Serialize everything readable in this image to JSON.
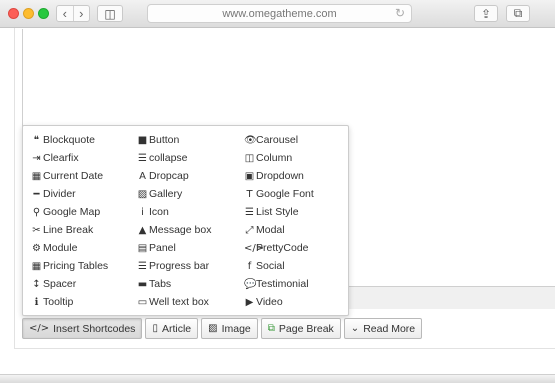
{
  "browser": {
    "url": "www.omegatheme.com",
    "back_glyph": "‹",
    "forward_glyph": "›",
    "sidebar_glyph": "◫",
    "reload_glyph": "↻",
    "share_glyph": "⇪",
    "tabs_glyph": "⧉"
  },
  "shortcodes": [
    {
      "label": "Blockquote",
      "glyph": "❝",
      "icon": "quote-icon"
    },
    {
      "label": "Button",
      "glyph": "■",
      "icon": "square-icon"
    },
    {
      "label": "Carousel",
      "glyph": "👁",
      "icon": "eye-icon"
    },
    {
      "label": "Clearfix",
      "glyph": "⇥",
      "icon": "sign-in-icon"
    },
    {
      "label": "collapse",
      "glyph": "☰",
      "icon": "list-icon"
    },
    {
      "label": "Column",
      "glyph": "◫",
      "icon": "columns-icon"
    },
    {
      "label": "Current Date",
      "glyph": "▦",
      "icon": "calendar-icon"
    },
    {
      "label": "Dropcap",
      "glyph": "A",
      "icon": "font-icon"
    },
    {
      "label": "Dropdown",
      "glyph": "▣",
      "icon": "caret-square-icon"
    },
    {
      "label": "Divider",
      "glyph": "━",
      "icon": "minus-icon"
    },
    {
      "label": "Gallery",
      "glyph": "▨",
      "icon": "picture-icon"
    },
    {
      "label": "Google Font",
      "glyph": "T",
      "icon": "text-height-icon"
    },
    {
      "label": "Google Map",
      "glyph": "⚲",
      "icon": "map-marker-icon"
    },
    {
      "label": "Icon",
      "glyph": "i",
      "icon": "info-icon"
    },
    {
      "label": "List Style",
      "glyph": "☰",
      "icon": "list-ul-icon"
    },
    {
      "label": "Line Break",
      "glyph": "✂",
      "icon": "scissors-icon"
    },
    {
      "label": "Message box",
      "glyph": "▲",
      "icon": "warning-icon"
    },
    {
      "label": "Modal",
      "glyph": "⤢",
      "icon": "expand-icon"
    },
    {
      "label": "Module",
      "glyph": "⚙",
      "icon": "cubes-icon"
    },
    {
      "label": "Panel",
      "glyph": "▤",
      "icon": "panel-icon"
    },
    {
      "label": "PrettyCode",
      "glyph": "</>",
      "icon": "code-icon"
    },
    {
      "label": "Pricing Tables",
      "glyph": "▦",
      "icon": "table-icon"
    },
    {
      "label": "Progress bar",
      "glyph": "☰",
      "icon": "tasks-icon"
    },
    {
      "label": "Social",
      "glyph": "f",
      "icon": "facebook-icon"
    },
    {
      "label": "Spacer",
      "glyph": "↕",
      "icon": "arrows-v-icon"
    },
    {
      "label": "Tabs",
      "glyph": "▬",
      "icon": "folder-icon"
    },
    {
      "label": "Testimonial",
      "glyph": "💬",
      "icon": "comment-icon"
    },
    {
      "label": "Tooltip",
      "glyph": "ℹ",
      "icon": "info-circle-icon"
    },
    {
      "label": "Well text box",
      "glyph": "▭",
      "icon": "square-o-icon"
    },
    {
      "label": "Video",
      "glyph": "▶",
      "icon": "video-camera-icon"
    }
  ],
  "buttons": {
    "insert_shortcodes": {
      "label": "Insert Shortcodes",
      "glyph": "</>"
    },
    "article": {
      "label": "Article",
      "glyph": "▯"
    },
    "image": {
      "label": "Image",
      "glyph": "▨"
    },
    "page_break": {
      "label": "Page Break",
      "glyph": "⧉"
    },
    "read_more": {
      "label": "Read More",
      "glyph": "⌄"
    }
  }
}
